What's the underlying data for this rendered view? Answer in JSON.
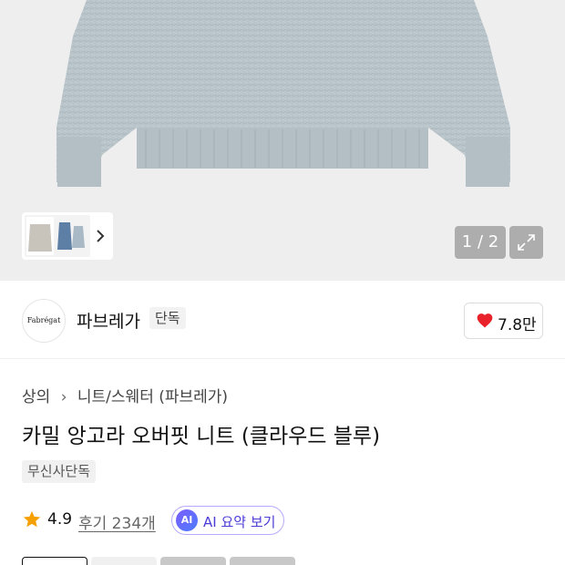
{
  "gallery": {
    "pager": "1 / 2",
    "thumbnail_next_icon": "chevron-right-icon",
    "expand_icon": "expand-icon"
  },
  "brand": {
    "logo_text": "Fabrégat",
    "name": "파브레가",
    "badge": "단독"
  },
  "like": {
    "icon": "heart-icon",
    "color": "#e8212b",
    "count": "7.8만"
  },
  "breadcrumb": {
    "items": [
      "상의",
      "니트/스웨터 (파브레가)"
    ]
  },
  "product": {
    "title": "카밀 앙고라 오버핏 니트 (클라우드 블루)",
    "exclusive_tag": "무신사단독"
  },
  "rating": {
    "star_icon": "star-icon",
    "star_color": "#f59f00",
    "value": "4.9",
    "reviews": "후기 234개"
  },
  "ai_summary": {
    "badge": "AI",
    "label": "AI 요약 보기"
  },
  "colors": {
    "sweater": "#b7c3c8",
    "accent_purple": "#6c5cff"
  }
}
